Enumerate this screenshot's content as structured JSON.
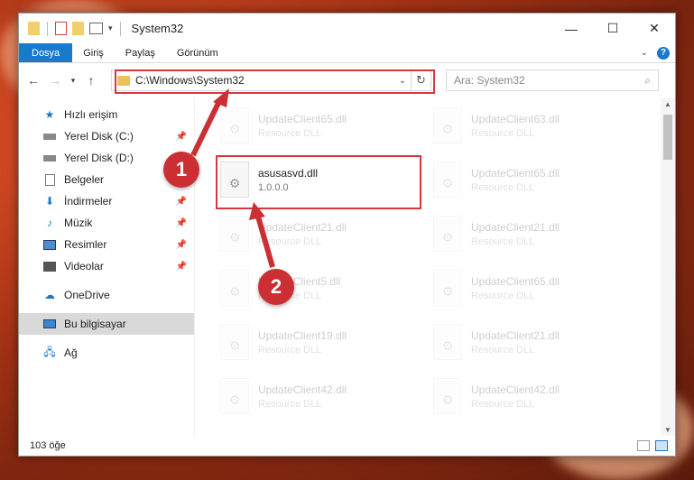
{
  "window": {
    "title": "System32",
    "controls": {
      "minimize": "—",
      "maximize": "☐",
      "close": "✕"
    }
  },
  "ribbon": {
    "tabs": [
      "Dosya",
      "Giriş",
      "Paylaş",
      "Görünüm"
    ],
    "help": "?"
  },
  "address": {
    "path": "C:\\Windows\\System32",
    "search_placeholder": "Ara: System32"
  },
  "sidebar": {
    "quick_access": "Hızlı erişim",
    "quick_items": [
      {
        "label": "Yerel Disk (C:)",
        "icon": "drive-icon"
      },
      {
        "label": "Yerel Disk (D:)",
        "icon": "drive-icon"
      },
      {
        "label": "Belgeler",
        "icon": "documents-icon"
      },
      {
        "label": "İndirmeler",
        "icon": "downloads-icon"
      },
      {
        "label": "Müzik",
        "icon": "music-icon"
      },
      {
        "label": "Resimler",
        "icon": "pictures-icon"
      },
      {
        "label": "Videolar",
        "icon": "videos-icon"
      }
    ],
    "onedrive": "OneDrive",
    "this_pc": "Bu bilgisayar",
    "network": "Ağ"
  },
  "files": {
    "selected": {
      "name": "asusasvd.dll",
      "sub": "1.0.0.0"
    },
    "left": [
      {
        "name": "UpdateClient65.dll",
        "sub": "Resource DLL"
      },
      {
        "name": "UpdateClient21.dll",
        "sub": "Resource DLL"
      },
      {
        "name": "UpdateClient5.dll",
        "sub": "Resource DLL"
      },
      {
        "name": "UpdateClient19.dll",
        "sub": "Resource DLL"
      },
      {
        "name": "UpdateClient42.dll",
        "sub": "Resource DLL"
      }
    ],
    "right": [
      {
        "name": "UpdateClient63.dll",
        "sub": "Resource DLL"
      },
      {
        "name": "UpdateClient65.dll",
        "sub": "Resource DLL"
      },
      {
        "name": "UpdateClient21.dll",
        "sub": "Resource DLL"
      },
      {
        "name": "UpdateClient65.dll",
        "sub": "Resource DLL"
      },
      {
        "name": "UpdateClient21.dll",
        "sub": "Resource DLL"
      },
      {
        "name": "UpdateClient42.dll",
        "sub": "Resource DLL"
      }
    ]
  },
  "status": {
    "count": "103 öğe"
  },
  "callouts": {
    "one": "1",
    "two": "2"
  },
  "colors": {
    "accent": "#1979ca",
    "highlight": "#d9363b",
    "badge": "#cc2f33"
  }
}
